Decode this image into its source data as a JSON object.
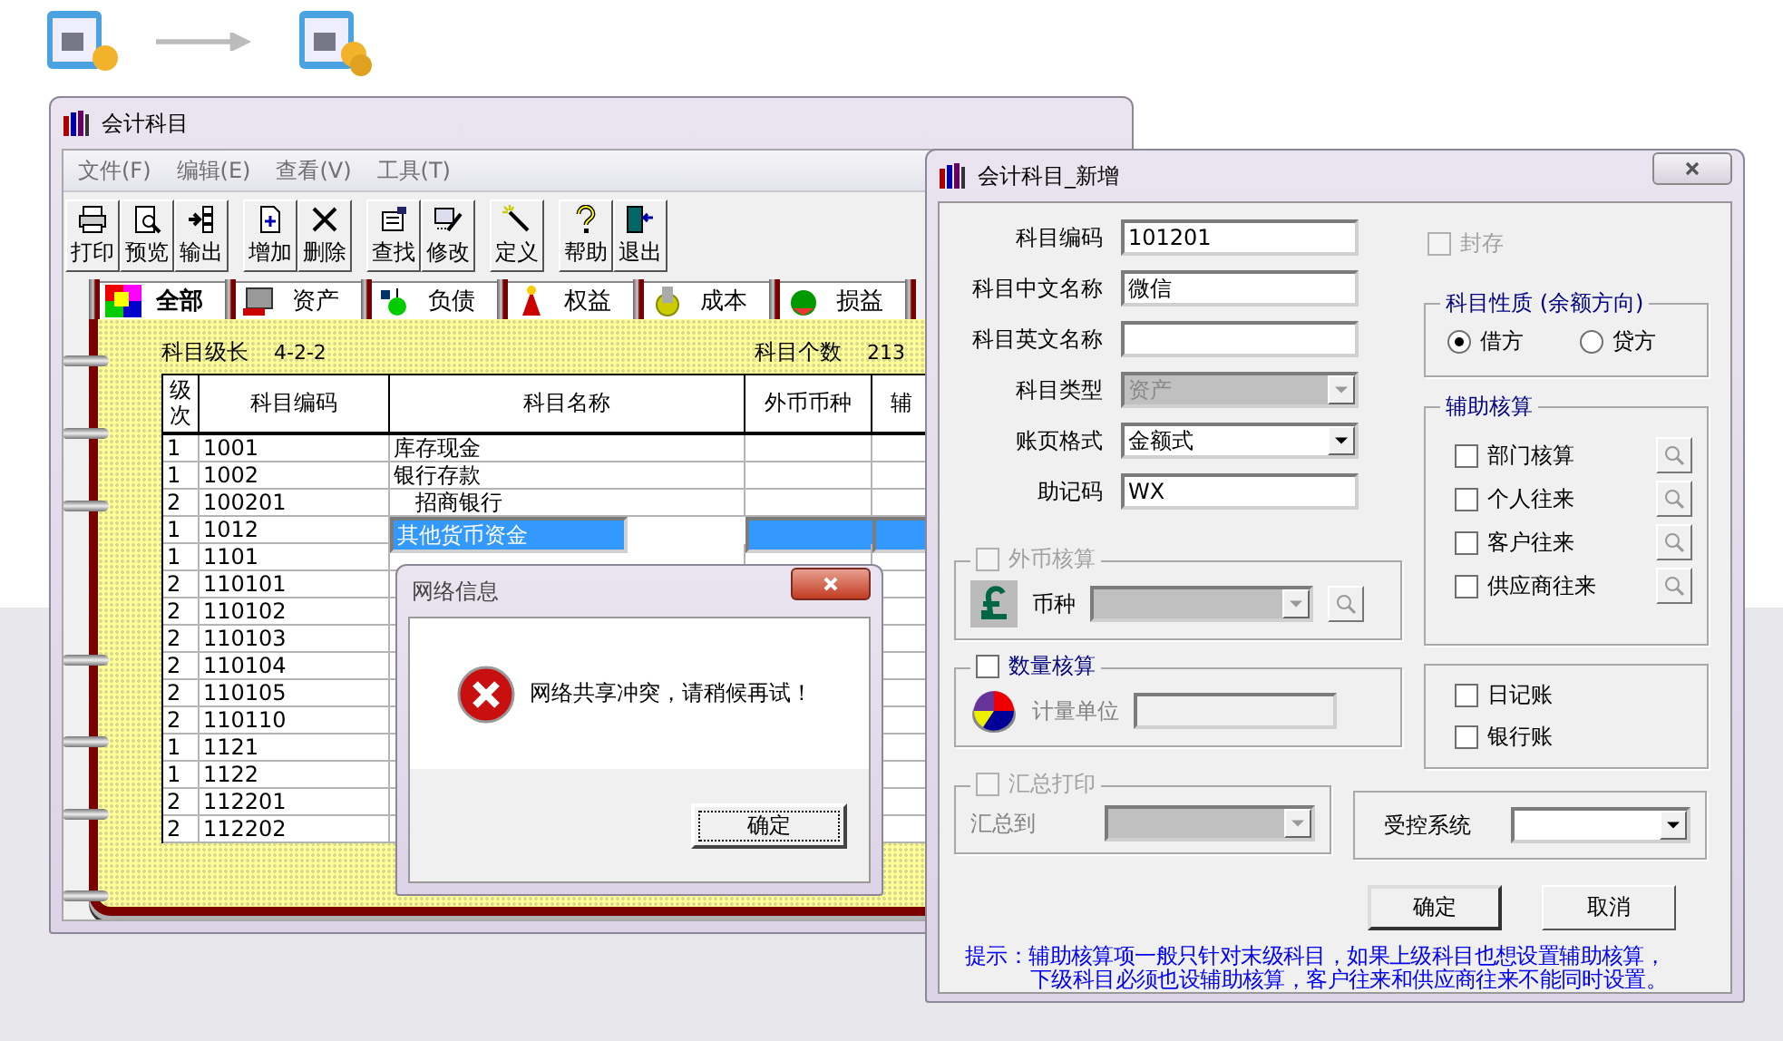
{
  "main_window": {
    "title": "会计科目",
    "menu": [
      {
        "label": "文件(F)"
      },
      {
        "label": "编辑(E)"
      },
      {
        "label": "查看(V)"
      },
      {
        "label": "工具(T)"
      }
    ],
    "toolbar_groups": [
      [
        {
          "label": "打印",
          "kind": "print"
        },
        {
          "label": "预览",
          "kind": "preview"
        },
        {
          "label": "输出",
          "kind": "export"
        }
      ],
      [
        {
          "label": "增加",
          "kind": "add"
        },
        {
          "label": "删除",
          "kind": "delete"
        }
      ],
      [
        {
          "label": "查找",
          "kind": "find"
        },
        {
          "label": "修改",
          "kind": "edit"
        }
      ],
      [
        {
          "label": "定义",
          "kind": "define"
        }
      ],
      [
        {
          "label": "帮助",
          "kind": "help"
        },
        {
          "label": "退出",
          "kind": "exit"
        }
      ]
    ],
    "tabs": [
      {
        "label": "全部",
        "selected": true
      },
      {
        "label": "资产",
        "selected": false
      },
      {
        "label": "负债",
        "selected": false
      },
      {
        "label": "权益",
        "selected": false
      },
      {
        "label": "成本",
        "selected": false
      },
      {
        "label": "损益",
        "selected": false
      }
    ],
    "info": {
      "length_label": "科目级长",
      "length_value": "4-2-2",
      "count_label": "科目个数",
      "count_value": "213"
    },
    "table": {
      "columns": [
        "级次",
        "科目编码",
        "科目名称",
        "外币币种",
        "辅"
      ],
      "rows": [
        {
          "level": "1",
          "code": "1001",
          "name": "库存现金",
          "indented": false,
          "selected": false
        },
        {
          "level": "1",
          "code": "1002",
          "name": "银行存款",
          "indented": false,
          "selected": false
        },
        {
          "level": "2",
          "code": "100201",
          "name": "招商银行",
          "indented": true,
          "selected": false
        },
        {
          "level": "1",
          "code": "1012",
          "name": "其他货币资金",
          "indented": false,
          "selected": true
        },
        {
          "level": "1",
          "code": "1101",
          "selected": false
        },
        {
          "level": "2",
          "code": "110101",
          "selected": false
        },
        {
          "level": "2",
          "code": "110102",
          "selected": false
        },
        {
          "level": "2",
          "code": "110103",
          "selected": false
        },
        {
          "level": "2",
          "code": "110104",
          "selected": false
        },
        {
          "level": "2",
          "code": "110105",
          "selected": false
        },
        {
          "level": "2",
          "code": "110110",
          "selected": false
        },
        {
          "level": "1",
          "code": "1121",
          "selected": false
        },
        {
          "level": "1",
          "code": "1122",
          "selected": false
        },
        {
          "level": "2",
          "code": "112201",
          "selected": false
        },
        {
          "level": "2",
          "code": "112202",
          "selected": false
        }
      ]
    }
  },
  "message_box": {
    "title": "网络信息",
    "message": "网络共享冲突，请稍候再试！",
    "button": "确定"
  },
  "dialog": {
    "title": "会计科目_新增",
    "fields": [
      {
        "label": "科目编码",
        "kind": "text",
        "value": "101201",
        "disabled": false
      },
      {
        "label": "科目中文名称",
        "kind": "text",
        "value": "微信",
        "disabled": false
      },
      {
        "label": "科目英文名称",
        "kind": "text",
        "disabled": false
      },
      {
        "label": "科目类型",
        "kind": "select",
        "value": "资产",
        "disabled": true
      },
      {
        "label": "账页格式",
        "kind": "select",
        "value": "金额式",
        "disabled": false
      },
      {
        "label": "助记码",
        "kind": "text",
        "value": "WX",
        "disabled": false
      }
    ],
    "archive": {
      "label": "封存",
      "checked": false,
      "disabled": true
    },
    "balance_direction": {
      "title": "科目性质 (余额方向)",
      "options": [
        {
          "label": "借方",
          "selected": true
        },
        {
          "label": "贷方",
          "selected": false
        }
      ]
    },
    "auxiliary": {
      "title": "辅助核算",
      "items": [
        {
          "label": "部门核算",
          "checked": false
        },
        {
          "label": "个人往来",
          "checked": false
        },
        {
          "label": "客户往来",
          "checked": false
        },
        {
          "label": "供应商往来",
          "checked": false
        }
      ]
    },
    "books": [
      {
        "label": "日记账",
        "checked": false
      },
      {
        "label": "银行账",
        "checked": false
      }
    ],
    "foreign_currency": {
      "label": "外币核算",
      "checked": false,
      "disabled": true,
      "currency_label": "币种"
    },
    "quantity": {
      "label": "数量核算",
      "checked": false,
      "disabled": false,
      "unit_label": "计量单位"
    },
    "summary_print": {
      "label": "汇总打印",
      "checked": false,
      "disabled": true,
      "target_label": "汇总到"
    },
    "controlled_system": {
      "label": "受控系统"
    },
    "buttons": [
      {
        "label": "确定",
        "default": true
      },
      {
        "label": "取消",
        "default": false
      }
    ],
    "hint": {
      "label": "提示：",
      "lines": [
        "辅助核算项一般只针对末级科目，如果上级科目也想设置辅助核算，",
        "下级科目必须也设辅助核算，客户往来和供应商往来不能同时设置。"
      ]
    }
  }
}
